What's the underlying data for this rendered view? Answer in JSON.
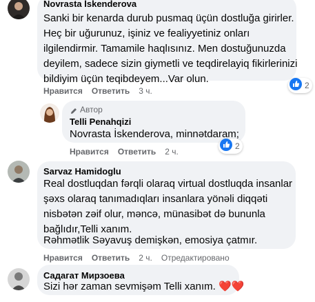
{
  "comments": [
    {
      "author": "Novrasta İskenderova",
      "lines": [
        "Sanki bir kenarda durub pusmaq üçün dostluğa girirler.",
        "Heç bir uğurunuz, işiniz ve fealiyyetiniz onları",
        "ilgilendirmir. Tamamile haqlısınız. Men dostuğunuzda",
        "deyilem, sadece sizin giymetli ve teqdirelayiq fikirlerinizi",
        "bildiyim üçün teqibdeyem...Var olun."
      ],
      "actions": {
        "like": "Нравится",
        "reply": "Ответить",
        "time": "3 ч."
      },
      "reactions": {
        "count": "2"
      }
    },
    {
      "badge": "Автор",
      "author": "Telli Penahqizi",
      "lines": [
        "Novrasta İskenderova, minnətdaram;"
      ],
      "actions": {
        "like": "Нравится",
        "reply": "Ответить",
        "time": "2 ч."
      },
      "reactions": {
        "count": "2"
      }
    },
    {
      "author": "Sarvaz Hamidoglu",
      "lines": [
        "Real dostluqdan fərqli olaraq virtual dostluqda insanlar",
        "şəxs olaraq tanımadıqları insanlara yönəli diqqəti",
        "nisbətən zəif olur, məncə, münasibət də bununla",
        "bağlıdır,Telli xanım.",
        "Rəhmətlik Səyavuş demişkən, emosiya çatmır."
      ],
      "actions": {
        "like": "Нравится",
        "reply": "Ответить",
        "time": "2 ч.",
        "edited": "Отредактировано"
      }
    },
    {
      "author": "Садагат Мирзоева",
      "lines": [
        "Sizi hər zaman sevmişəm Telli xanım."
      ],
      "emoji": "❤️❤️"
    }
  ],
  "colors": {
    "like_blue": "#1877f2",
    "bubble_bg": "#f0f2f5",
    "meta_gray": "#65676b"
  }
}
